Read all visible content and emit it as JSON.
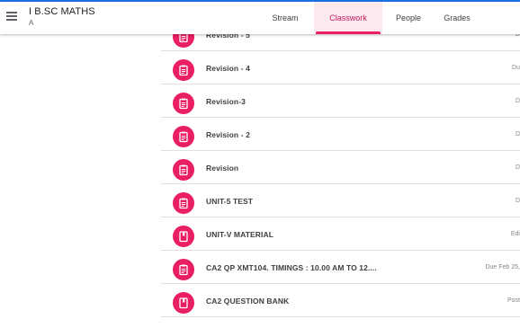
{
  "header": {
    "class_title": "I B.SC MATHS",
    "class_section": "A",
    "tabs": [
      {
        "label": "Stream",
        "active": false
      },
      {
        "label": "Classwork",
        "active": true
      },
      {
        "label": "People",
        "active": false
      },
      {
        "label": "Grades",
        "active": false
      }
    ]
  },
  "colors": {
    "accent": "#e91e63",
    "active_tab_bg": "#fce8ef",
    "top_border": "#1a73e8"
  },
  "classwork": [
    {
      "title": "Revision - 5",
      "meta": "D",
      "icon": "assignment-icon"
    },
    {
      "title": "Revision - 4",
      "meta": "Du",
      "icon": "assignment-icon"
    },
    {
      "title": "Revision-3",
      "meta": "D",
      "icon": "assignment-icon"
    },
    {
      "title": "Revision - 2",
      "meta": "D",
      "icon": "assignment-icon"
    },
    {
      "title": "Revision",
      "meta": "D",
      "icon": "assignment-icon"
    },
    {
      "title": "UNIT-5 TEST",
      "meta": "D",
      "icon": "assignment-icon"
    },
    {
      "title": "UNIT-V MATERIAL",
      "meta": "Edi",
      "icon": "material-icon"
    },
    {
      "title": "CA2 QP XMT104. TIMINGS : 10.00 AM TO 12....",
      "meta": "Due Feb 25,",
      "icon": "assignment-icon"
    },
    {
      "title": "CA2 QUESTION BANK",
      "meta": "Post",
      "icon": "material-icon"
    }
  ]
}
